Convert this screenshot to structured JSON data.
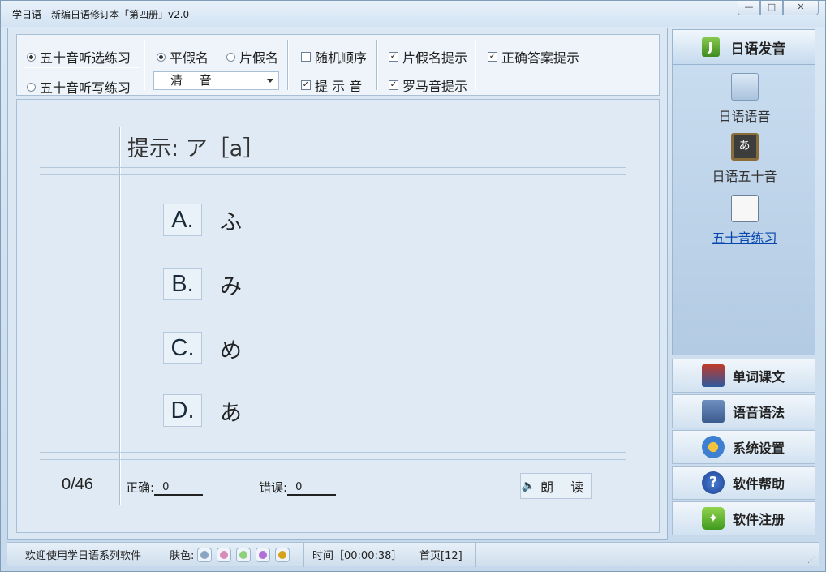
{
  "window": {
    "title": "学日语—新编日语修订本「第四册」v2.0",
    "buttons": [
      "—",
      "□",
      "✕"
    ]
  },
  "toolbar": {
    "mode_choice": "五十音听选练习",
    "mode_write": "五十音听写练习",
    "hiragana": "平假名",
    "katakana": "片假名",
    "random_order": "随机顺序",
    "hint_sound": "提 示 音",
    "katakana_hint": "片假名提示",
    "romaji_hint": "罗马音提示",
    "answer_hint": "正确答案提示",
    "sound_type": "清 音"
  },
  "quiz": {
    "hint": "提示: ア［a］",
    "choices": [
      {
        "letter": "A.",
        "kana": "ふ"
      },
      {
        "letter": "B.",
        "kana": "み"
      },
      {
        "letter": "C.",
        "kana": "め"
      },
      {
        "letter": "D.",
        "kana": "あ"
      }
    ],
    "progress": "0/46",
    "correct_label": "正确:",
    "correct_value": "0",
    "wrong_label": "错误:",
    "wrong_value": "0",
    "read_button": "朗 读"
  },
  "sidebar": {
    "header": "日语发音",
    "header_icon": "J",
    "items": [
      {
        "label": "日语语音",
        "icon": "notebook-icon"
      },
      {
        "label": "日语五十音",
        "icon": "blackboard-icon",
        "glyph": "あ"
      },
      {
        "label": "五十音练习",
        "icon": "list-icon"
      }
    ],
    "buttons": [
      {
        "label": "单词课文",
        "icon": "books-icon"
      },
      {
        "label": "语音语法",
        "icon": "audio-book-icon"
      },
      {
        "label": "系统设置",
        "icon": "gears-icon"
      },
      {
        "label": "软件帮助",
        "icon": "help-icon",
        "glyph": "?"
      },
      {
        "label": "软件注册",
        "icon": "register-icon",
        "glyph": "✦"
      }
    ]
  },
  "statusbar": {
    "welcome": "欢迎使用学日语系列软件",
    "skin_label": "肤色:",
    "skin_colors": [
      "#8aa5c4",
      "#d98bb8",
      "#8fd07c",
      "#b06fd6",
      "#d6a21c"
    ],
    "time": "时间［00:00:38］",
    "page": "首页[12]"
  },
  "colors": {
    "link": "#0645ad",
    "panel": "#dbe8f4",
    "border": "#a9bfd6"
  }
}
